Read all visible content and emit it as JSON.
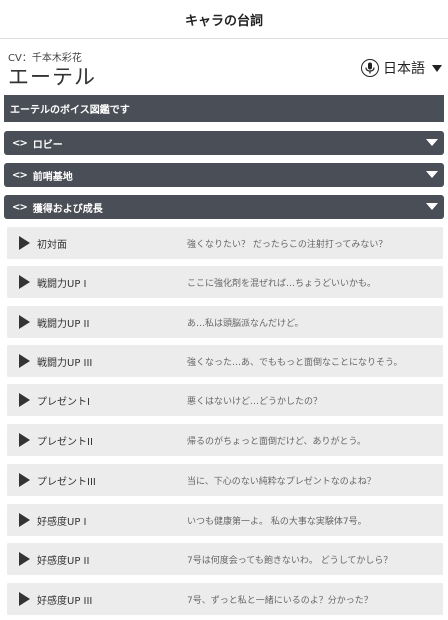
{
  "header": {
    "title": "キャラの台詞"
  },
  "character": {
    "cv": "CV：千本木彩花",
    "name": "エーテル"
  },
  "language": {
    "selected": "日本語",
    "icon": "microphone-icon"
  },
  "voice_section": {
    "title": "エーテルのボイス図鑑です"
  },
  "accordions": [
    {
      "label": "ロビー"
    },
    {
      "label": "前哨基地"
    },
    {
      "label": "獲得および成長"
    }
  ],
  "voices": [
    {
      "label": "初対面",
      "line": "強くなりたい？ だったらこの注射打ってみない？"
    },
    {
      "label": "戦闘力UP I",
      "line": "ここに強化剤を混ぜれば…ちょうどいいかも。"
    },
    {
      "label": "戦闘力UP II",
      "line": "あ…私は頭脳派なんだけど。"
    },
    {
      "label": "戦闘力UP III",
      "line": "強くなった…あ、でももっと面倒なことになりそう。"
    },
    {
      "label": "プレゼントI",
      "line": "悪くはないけど…どうかしたの？"
    },
    {
      "label": "プレゼントII",
      "line": "帰るのがちょっと面倒だけど、ありがとう。"
    },
    {
      "label": "プレゼントIII",
      "line": "当に、下心のない純粋なプレゼントなのよね？"
    },
    {
      "label": "好感度UP I",
      "line": "いつも健康第一よ。 私の大事な実験体7号。"
    },
    {
      "label": "好感度UP II",
      "line": "7号は何度会っても飽きないわ。 どうしてかしら？"
    },
    {
      "label": "好感度UP III",
      "line": "7号、ずっと私と一緒にいるのよ？分かった？"
    }
  ]
}
